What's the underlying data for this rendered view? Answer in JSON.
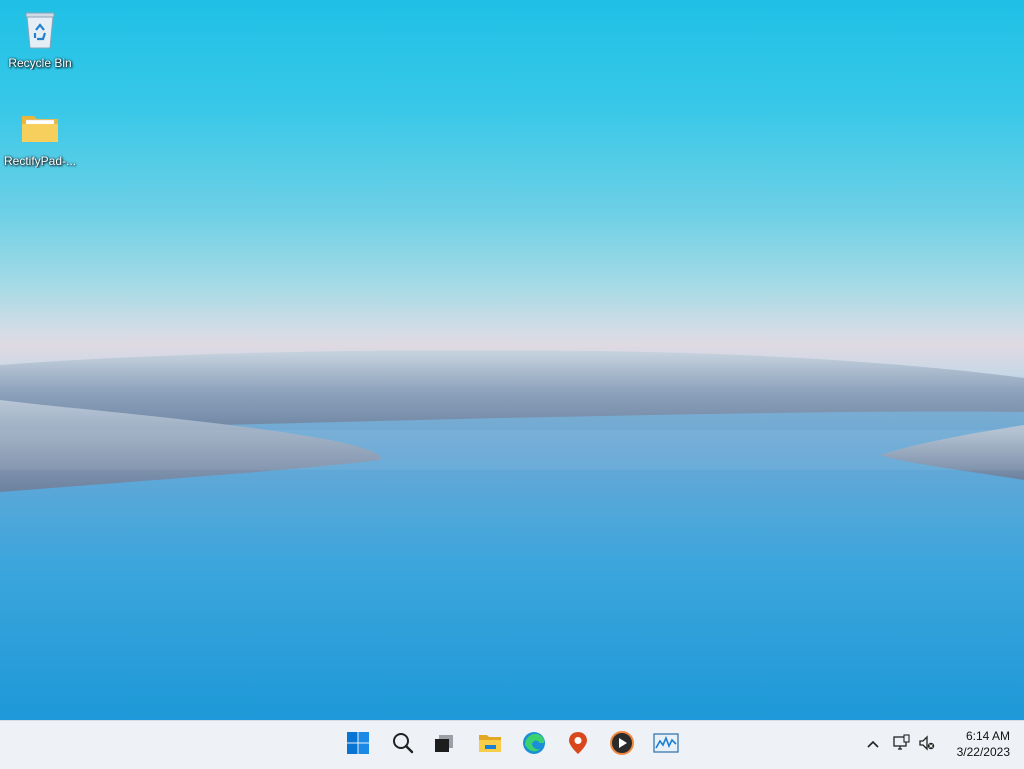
{
  "desktop": {
    "icons": [
      {
        "label": "Recycle Bin",
        "icon": "recycle-bin-icon"
      },
      {
        "label": "RectifyPad-...",
        "icon": "folder-icon"
      }
    ]
  },
  "taskbar": {
    "apps": [
      {
        "name": "start",
        "icon": "windows-logo-icon"
      },
      {
        "name": "search",
        "icon": "search-icon"
      },
      {
        "name": "task-view",
        "icon": "task-view-icon"
      },
      {
        "name": "file-explorer",
        "icon": "folder-icon"
      },
      {
        "name": "edge",
        "icon": "edge-icon"
      },
      {
        "name": "maps",
        "icon": "map-pin-icon"
      },
      {
        "name": "media-player",
        "icon": "play-icon"
      },
      {
        "name": "performance-monitor",
        "icon": "chart-icon"
      }
    ],
    "tray": {
      "icons": [
        "chevron-up-icon",
        "network-icon",
        "volume-muted-icon"
      ]
    },
    "clock": {
      "time": "6:14 AM",
      "date": "3/22/2023"
    }
  },
  "colors": {
    "sky_top": "#1fc0e6",
    "water": "#2a9fd6",
    "taskbar_bg": "#eef2f6",
    "accent": "#0078d4"
  }
}
